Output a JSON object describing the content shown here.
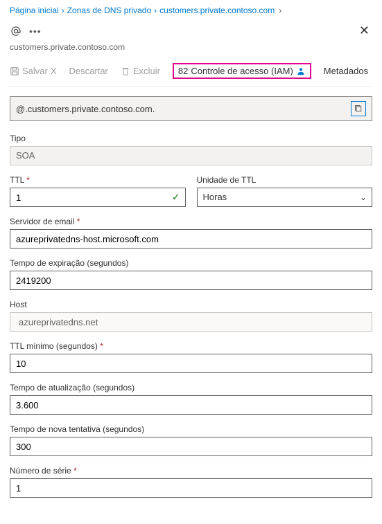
{
  "breadcrumb": {
    "home": "Página inicial",
    "zones": "Zonas de DNS privado",
    "zone": "customers.private.contoso.com"
  },
  "header": {
    "subtitle": "customers.private.contoso.com"
  },
  "toolbar": {
    "save": "Salvar",
    "save_shortcut": "X",
    "discard": "Descartar",
    "delete": "Excluir",
    "access": "Controle de acesso (IAM)",
    "access_prefix": "82",
    "metadata": "Metadados"
  },
  "record": {
    "name": "@.customers.private.contoso.com."
  },
  "fields": {
    "type_label": "Tipo",
    "type_value": "SOA",
    "ttl_label": "TTL",
    "ttl_value": "1",
    "ttl_unit_label": "Unidade de TTL",
    "ttl_unit_value": "Horas",
    "email_label": "Servidor de email",
    "email_value": "azureprivatedns-host.microsoft.com",
    "expire_label": "Tempo de expiração (segundos)",
    "expire_value": "2419200",
    "host_label": "Host",
    "host_value": "azureprivatedns.net",
    "min_ttl_label": "TTL mínimo (segundos)",
    "min_ttl_value": "10",
    "refresh_label": "Tempo de atualização (segundos)",
    "refresh_value": "3.600",
    "retry_label": "Tempo de nova tentativa (segundos)",
    "retry_value": "300",
    "serial_label": "Número de série",
    "serial_value": "1"
  }
}
